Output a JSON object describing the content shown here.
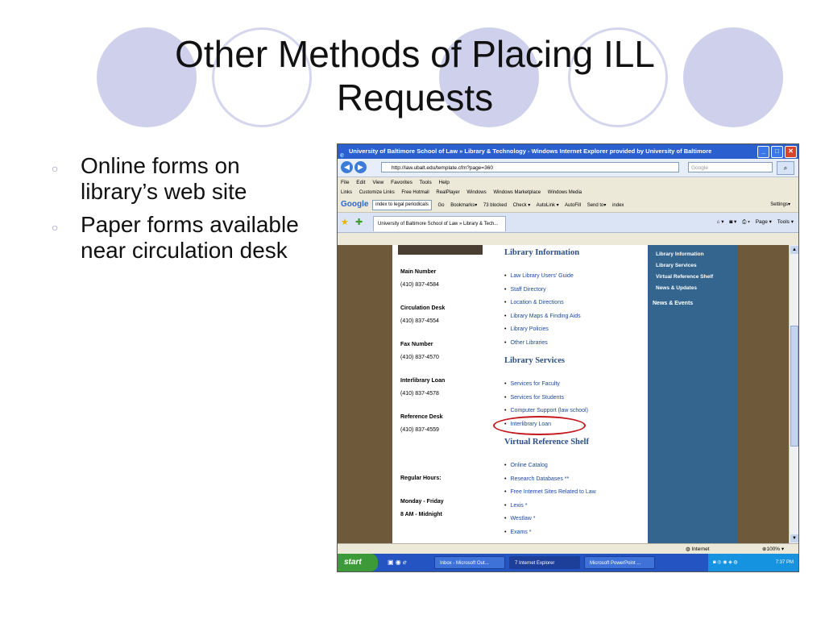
{
  "slide": {
    "title": "Other Methods of Placing ILL Requests",
    "bullets": [
      "Online forms on library’s web site",
      "Paper forms available near circulation desk"
    ]
  },
  "colors": {
    "circle_fill": "#cfd1ec",
    "bullet": "#8c8fc6",
    "ie_title": "#2a5fcf",
    "nav_blue": "#33658f",
    "brown": "#6e5a3a",
    "ring": "#c4161c"
  },
  "browser": {
    "title": "University of Baltimore School of Law » Library & Technology - Windows Internet Explorer provided by University of Baltimore",
    "url": "http://law.ubalt.edu/template.cfm?page=360",
    "search_placeholder": "Google",
    "menu": [
      "File",
      "Edit",
      "View",
      "Favorites",
      "Tools",
      "Help"
    ],
    "links_label": "Links",
    "links": [
      "Customize Links",
      "Free Hotmail",
      "RealPlayer",
      "Windows",
      "Windows Marketplace",
      "Windows Media"
    ],
    "google_bar": {
      "logo": "Google",
      "query": "index to legal periodicals",
      "go": "Go",
      "bookmarks": "Bookmarks▾",
      "blocked": "73 blocked",
      "check": "Check ▾",
      "autolink": "AutoLink ▾",
      "autofill": "AutoFill",
      "send_to": "Send to▾",
      "index": "index",
      "settings": "Settings▾"
    },
    "tab_label": "University of Baltimore School of Law » Library & Tech...",
    "tools": {
      "page": "Page ▾",
      "tools": "Tools ▾"
    },
    "status": {
      "zone": "Internet",
      "zoom": "100%"
    }
  },
  "page": {
    "contacts": [
      {
        "label": "Main Number",
        "value": "(410) 837-4584"
      },
      {
        "label": "Circulation Desk",
        "value": "(410) 837-4554"
      },
      {
        "label": "Fax Number",
        "value": "(410) 837-4570"
      },
      {
        "label": "Interlibrary Loan",
        "value": "(410) 837-4578"
      },
      {
        "label": "Reference Desk",
        "value": "(410) 837-4559"
      }
    ],
    "hours_label": "Regular Hours:",
    "hours_days": "Monday - Friday",
    "hours_time": "8 AM - Midnight",
    "sections": [
      {
        "heading": "Library Information",
        "links": [
          "Law Library Users' Guide",
          "Staff Directory",
          "Location & Directions",
          "Library Maps & Finding Aids",
          "Library Policies",
          "Other Libraries"
        ]
      },
      {
        "heading": "Library Services",
        "links": [
          "Services for Faculty",
          "Services for Students",
          "Computer Support (law school)",
          "Interlibrary Loan"
        ]
      },
      {
        "heading": "Virtual Reference Shelf",
        "links": [
          "Online Catalog",
          "Research Databases **",
          "Free Internet Sites Related to Law",
          "Lexis *",
          "Westlaw *",
          "Exams *"
        ]
      }
    ],
    "right_nav": [
      "Library Information",
      "Library Services",
      "Virtual Reference Shelf",
      "News & Updates"
    ],
    "right_nav_heading": "News & Events"
  },
  "taskbar": {
    "start": "start",
    "items": [
      "Inbox - Microsoft Out...",
      "7 Internet Explorer",
      "Microsoft PowerPoint ..."
    ],
    "clock": "7:37 PM"
  }
}
